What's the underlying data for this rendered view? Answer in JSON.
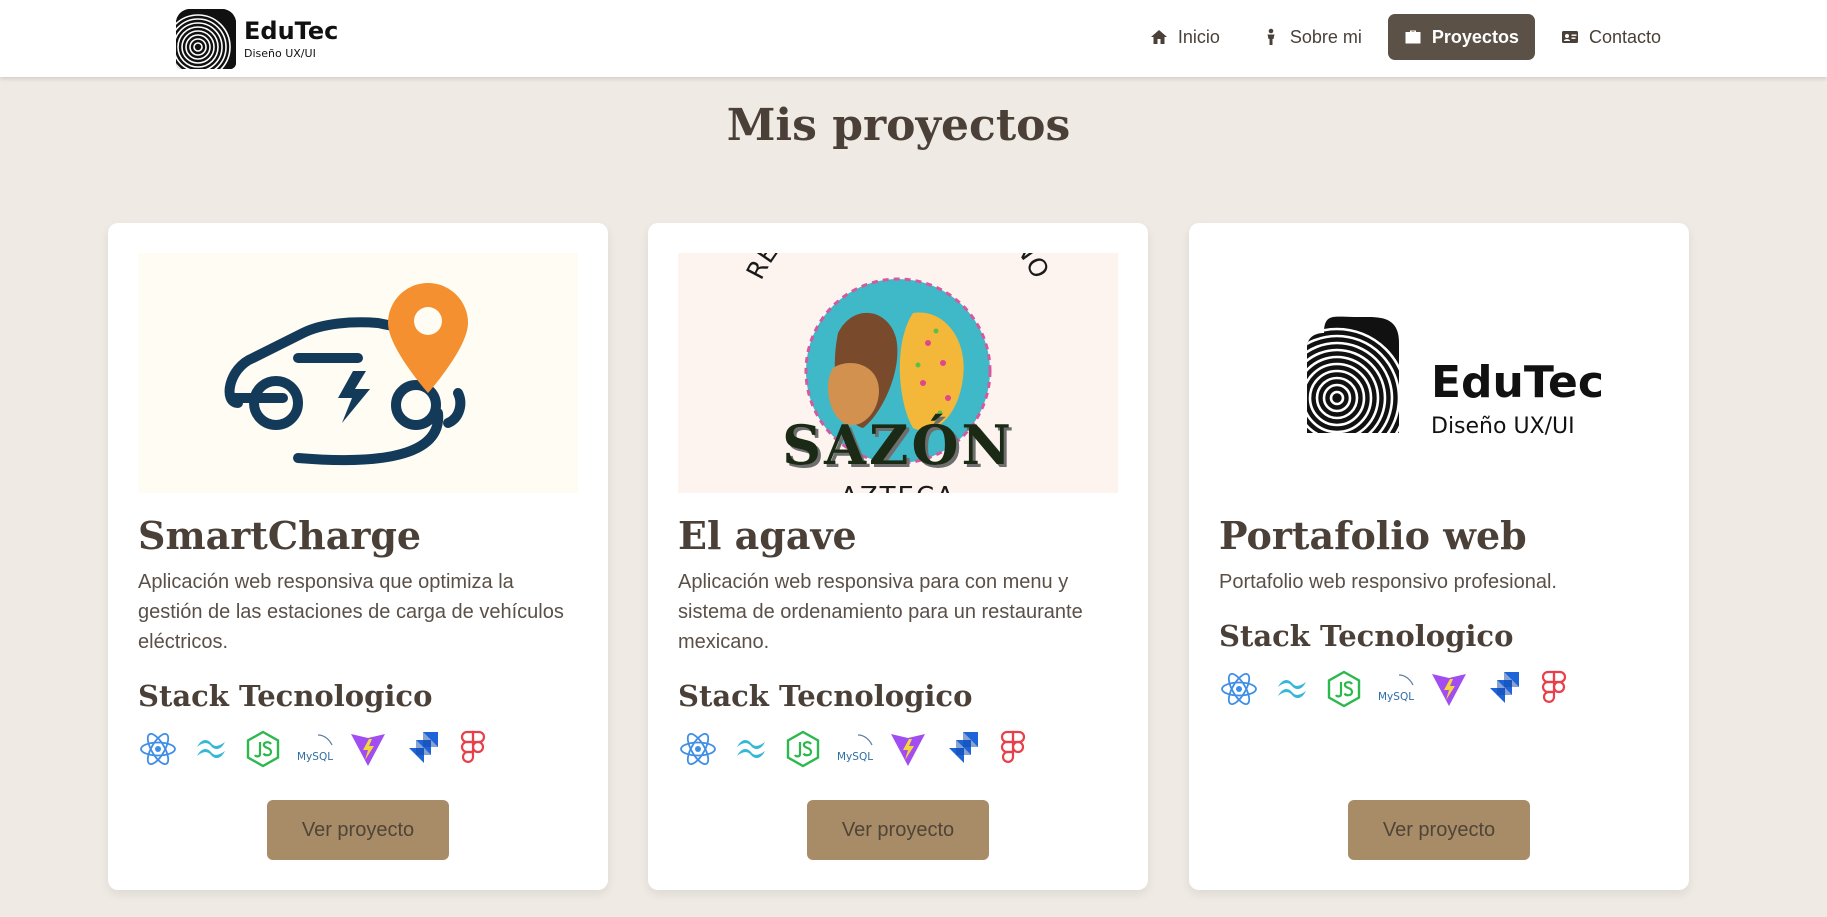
{
  "brand": {
    "name": "EduTec",
    "tagline": "Diseño UX/UI",
    "logo_icon": "fingerprint-logo-icon"
  },
  "nav": {
    "items": [
      {
        "label": "Inicio",
        "icon": "home-icon",
        "active": false
      },
      {
        "label": "Sobre mi",
        "icon": "person-icon",
        "active": false
      },
      {
        "label": "Proyectos",
        "icon": "briefcase-icon",
        "active": true
      },
      {
        "label": "Contacto",
        "icon": "contact-card-icon",
        "active": false
      }
    ]
  },
  "page": {
    "title": "Mis proyectos"
  },
  "projects": [
    {
      "title": "SmartCharge",
      "description": "Aplicación web responsiva que optimiza la gestión de las estaciones de carga de vehículos eléctricos.",
      "stack_title": "Stack Tecnologico",
      "stack": [
        "react-icon",
        "tailwind-icon",
        "nodejs-icon",
        "mysql-icon",
        "vite-icon",
        "jira-icon",
        "figma-icon"
      ],
      "button": "Ver proyecto",
      "image": "ev-charging-logo"
    },
    {
      "title": "El agave",
      "description": "Aplicación web responsiva para con menu y sistema de ordenamiento para un restaurante mexicano.",
      "stack_title": "Stack Tecnologico",
      "stack": [
        "react-icon",
        "tailwind-icon",
        "nodejs-icon",
        "mysql-icon",
        "vite-icon",
        "jira-icon",
        "figma-icon"
      ],
      "button": "Ver proyecto",
      "image": "restaurant-logo",
      "image_text": {
        "arc": "RESTAURANTE MEXICANO",
        "name": "SAZÓN",
        "bottom": "AZTECA"
      }
    },
    {
      "title": "Portafolio web",
      "description": "Portafolio web responsivo profesional.",
      "stack_title": "Stack Tecnologico",
      "stack": [
        "react-icon",
        "tailwind-icon",
        "nodejs-icon",
        "mysql-icon",
        "vite-icon",
        "jira-icon",
        "figma-icon"
      ],
      "button": "Ver proyecto",
      "image": "edutec-logo",
      "image_text": {
        "name": "EduTec",
        "tagline": "Diseño UX/UI"
      }
    }
  ],
  "tech_labels": {
    "mysql": "MySQL"
  },
  "colors": {
    "background": "#efeae4",
    "nav_active": "#5c5146",
    "button": "#a88c67",
    "text": "#4a4038"
  }
}
